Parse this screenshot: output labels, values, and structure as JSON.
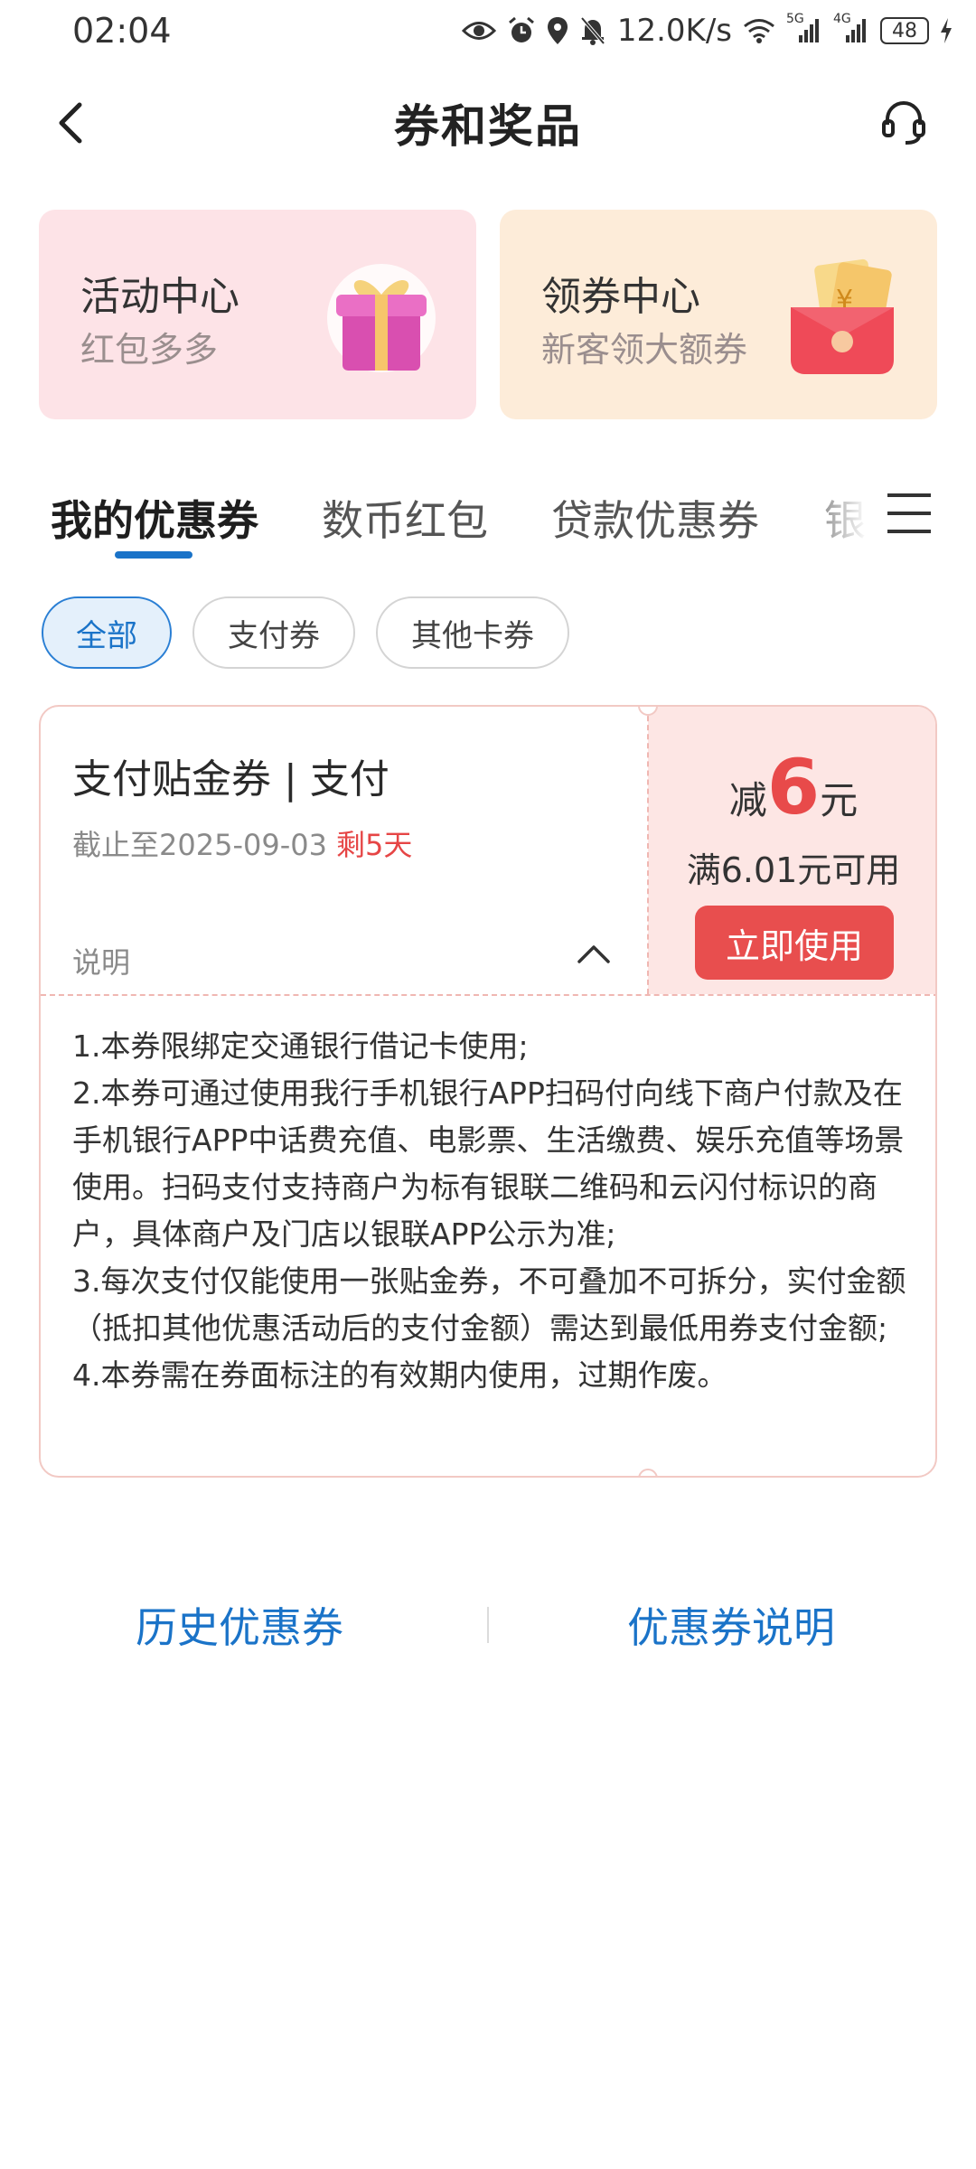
{
  "status_bar": {
    "time": "02:04",
    "net_speed": "12.0K/s",
    "battery": "48",
    "signal_1": "5G",
    "signal_2": "4G"
  },
  "header": {
    "title": "券和奖品"
  },
  "promos": [
    {
      "title": "活动中心",
      "subtitle": "红包多多",
      "icon": "gift-box-icon"
    },
    {
      "title": "领券中心",
      "subtitle": "新客领大额券",
      "icon": "red-envelope-icon"
    }
  ],
  "tabs": [
    {
      "label": "我的优惠券",
      "active": true
    },
    {
      "label": "数币红包"
    },
    {
      "label": "贷款优惠券"
    },
    {
      "label": "银联"
    }
  ],
  "filters": [
    {
      "label": "全部",
      "active": true
    },
    {
      "label": "支付券"
    },
    {
      "label": "其他卡券"
    }
  ],
  "coupon": {
    "title": "支付贴金券 | 支付",
    "expiry": "截止至2025-09-03",
    "remaining": "剩5天",
    "desc_label": "说明",
    "discount_prefix": "减",
    "discount_value": "6",
    "discount_unit": "元",
    "min_spend": "满6.01元可用",
    "use_button": "立即使用",
    "rules": [
      "1.本券限绑定交通银行借记卡使用;",
      "2.本券可通过使用我行手机银行APP扫码付向线下商户付款及在手机银行APP中话费充值、电影票、生活缴费、娱乐充值等场景使用。扫码支付支持商户为标有银联二维码和云闪付标识的商户，具体商户及门店以银联APP公示为准;",
      "3.每次支付仅能使用一张贴金券，不可叠加不可拆分，实付金额（抵扣其他优惠活动后的支付金额）需达到最低用券支付金额;",
      "4.本券需在券面标注的有效期内使用，过期作废。"
    ]
  },
  "footer": {
    "history": "历史优惠券",
    "explanation": "优惠券说明"
  },
  "colors": {
    "accent_blue": "#1a73c8",
    "coupon_red": "#e84a4a"
  }
}
